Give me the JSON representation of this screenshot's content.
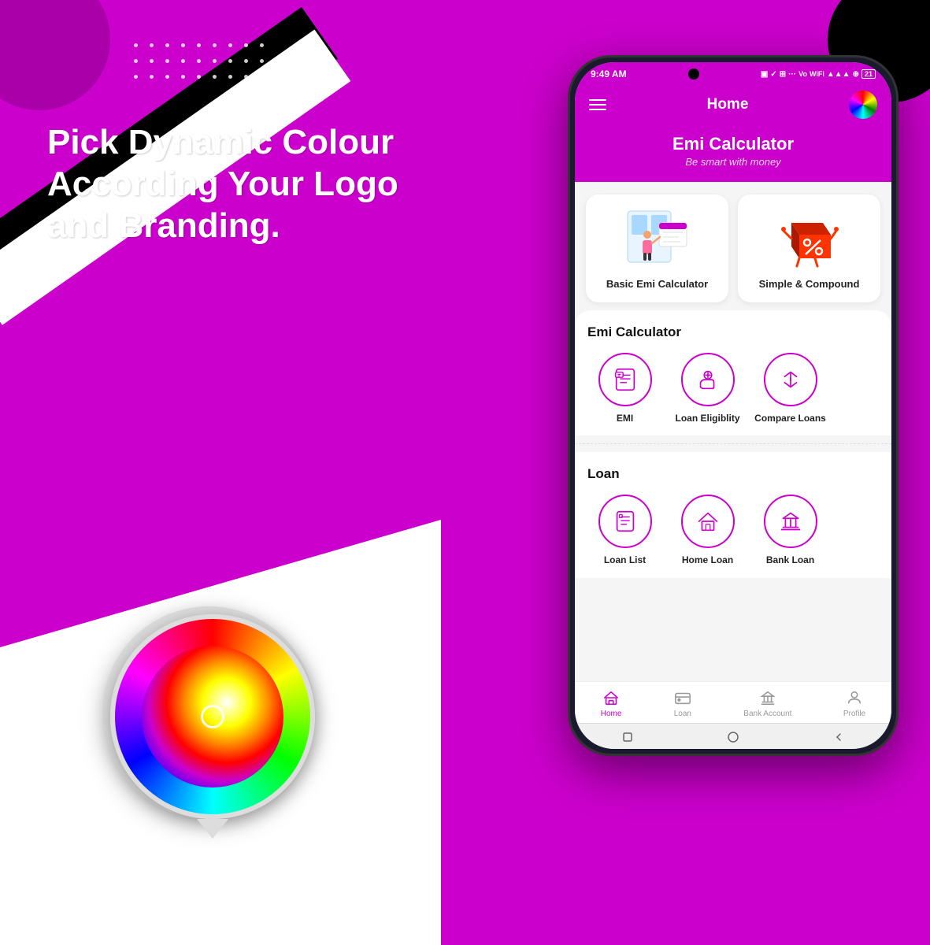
{
  "background": {
    "color": "#cc00cc"
  },
  "left_text": {
    "headline": "Pick Dynamic Colour According Your Logo and Branding."
  },
  "dots": {
    "count": 27
  },
  "phone": {
    "status_bar": {
      "time": "9:49 AM",
      "icons": "▣ ✓ ⊞ ···  Vo WiFi ▲▲▲ ⊕ 21"
    },
    "header": {
      "title": "Home",
      "menu_icon": "☰",
      "avatar_label": "color-avatar"
    },
    "hero": {
      "title": "Emi Calculator",
      "subtitle": "Be smart with money"
    },
    "top_cards": [
      {
        "id": "basic-emi",
        "label": "Basic Emi Calculator",
        "image_type": "emi-person"
      },
      {
        "id": "simple-compound",
        "label": "Simple & Compound",
        "image_type": "percentage-cube"
      }
    ],
    "sections": [
      {
        "id": "emi-calculator",
        "title": "Emi Calculator",
        "items": [
          {
            "id": "emi",
            "label": "EMI",
            "icon": "emi-icon"
          },
          {
            "id": "loan-eligibility",
            "label": "Loan\nEligiblity",
            "icon": "loan-eligibility-icon"
          },
          {
            "id": "compare-loans",
            "label": "Compare\nLoans",
            "icon": "compare-loans-icon"
          }
        ]
      },
      {
        "id": "loan",
        "title": "Loan",
        "items": [
          {
            "id": "loan-list",
            "label": "Loan List",
            "icon": "loan-list-icon"
          },
          {
            "id": "home-loan",
            "label": "Home Loan",
            "icon": "home-loan-icon"
          },
          {
            "id": "bank-loan",
            "label": "Bank Loan",
            "icon": "bank-loan-icon"
          }
        ]
      }
    ],
    "bottom_nav": [
      {
        "id": "home",
        "label": "Home",
        "icon": "home-nav-icon",
        "active": true
      },
      {
        "id": "loan",
        "label": "Loan",
        "icon": "loan-nav-icon",
        "active": false
      },
      {
        "id": "bank-account",
        "label": "Bank Account",
        "icon": "bank-nav-icon",
        "active": false
      },
      {
        "id": "profile",
        "label": "Profile",
        "icon": "profile-nav-icon",
        "active": false
      }
    ]
  }
}
